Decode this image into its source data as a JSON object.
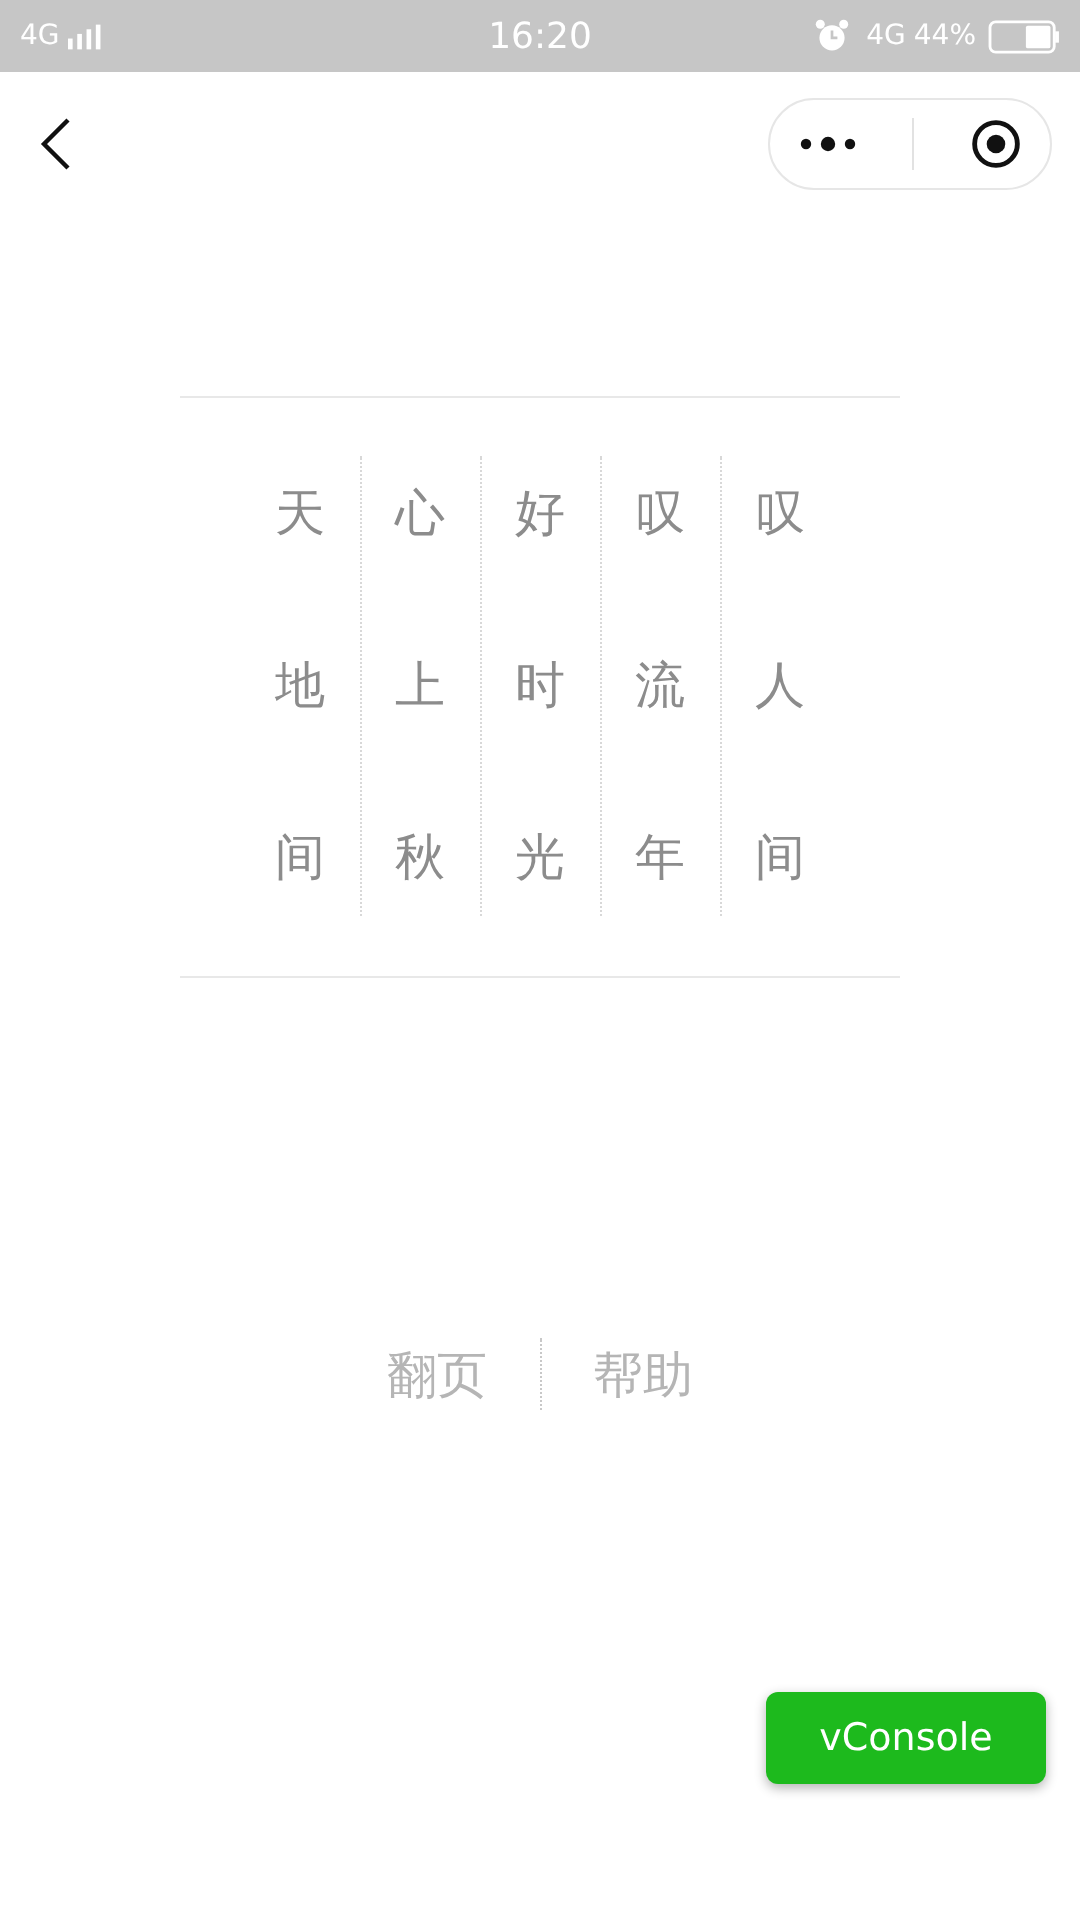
{
  "status_bar": {
    "network_left": "4G",
    "time": "16:20",
    "network_right": "4G",
    "battery": "44%"
  },
  "poem": {
    "columns": [
      "天地间",
      "心上秋",
      "好时光",
      "叹流年",
      "叹人间"
    ]
  },
  "footer_links": [
    "翻页",
    "帮助"
  ],
  "vconsole_button": "vConsole"
}
